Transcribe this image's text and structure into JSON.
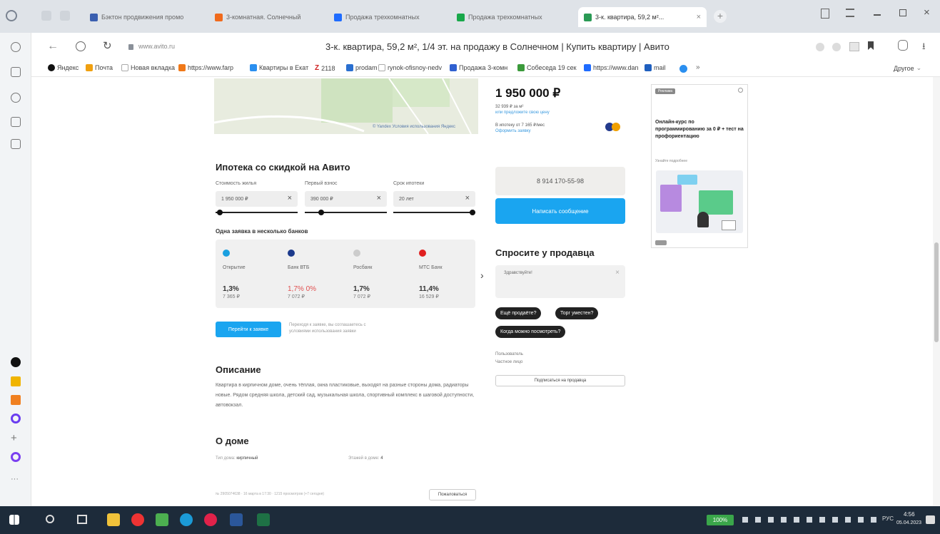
{
  "browser": {
    "tabs": [
      {
        "label": "Бэктон продвижения промо",
        "color": "#3a5fb0"
      },
      {
        "label": "3-комнатная. Солнечный",
        "color": "#f06a1c"
      },
      {
        "label": "Продажа трехкомнатных",
        "color": "#1f6cff"
      },
      {
        "label": "Продажа трехкомнатных",
        "color": "#18a84a"
      },
      {
        "label": "3-к. квартира, 59,2 м²...",
        "color": "#2a9a55"
      }
    ],
    "address": "www.avito.ru",
    "page_title": "3-к. квартира, 59,2 м², 1/4 эт. на продажу в Солнечном | Купить квартиру | Авито",
    "bookmarks": [
      {
        "label": "Яндекс",
        "color": "#e03131"
      },
      {
        "label": "Почта",
        "color": "#f0a010"
      },
      {
        "label": "Новая вкладка",
        "color": "#bbbbbb"
      },
      {
        "label": "https://www.farp",
        "color": "#f07818"
      },
      {
        "label": "Квартиры в Екат",
        "color": "#2a8ff0"
      },
      {
        "label": "2118",
        "color": "#d02020"
      },
      {
        "label": "prodam",
        "color": "#2a6fd0"
      },
      {
        "label": "rynok-ofisnoy-nedv",
        "color": "#999999"
      },
      {
        "label": "Продажа 3-комн",
        "color": "#3060d0"
      },
      {
        "label": "Собеседа 19 сек",
        "color": "#3b9a3b"
      },
      {
        "label": "https://www.dan",
        "color": "#1f6cff"
      },
      {
        "label": "mail",
        "color": "#1f5fbf"
      }
    ],
    "bookmarks_more": "Другое"
  },
  "map": {
    "attribution": "© Yandex  Условия использования  Яндекс"
  },
  "mortgage": {
    "title": "Ипотека со скидкой на Авито",
    "labels": [
      "Стоимость жилья",
      "Первый взнос",
      "Срок ипотеки"
    ],
    "values": [
      "1 950 000 ₽",
      "390 000 ₽",
      "20 лет"
    ],
    "slider_fractions": [
      0.05,
      0.2,
      1.0
    ],
    "multi_banks": "Одна заявка в несколько банков",
    "banks": [
      {
        "name": "Открытие",
        "rate": "1,3%",
        "pay": "7 365 ₽",
        "color": "#1aa0e0"
      },
      {
        "name": "Банк ВТБ",
        "rate": "1,7% 0%",
        "pay": "7 072 ₽",
        "color": "#1c3a8c"
      },
      {
        "name": "Росбанк",
        "rate": "1,7%",
        "pay": "7 072 ₽",
        "color": "#cccccc"
      },
      {
        "name": "МТС Банк",
        "rate": "11,4%",
        "pay": "16 529 ₽",
        "color": "#e02020"
      }
    ],
    "bank_arrow": "›",
    "button": "Перейти к заявке",
    "note": "Переходя к заявке, вы соглашаетесь с условиями использования заявки"
  },
  "description": {
    "title": "Описание",
    "text": "Квартира в кирпичном доме, очень тёплая, окна пластиковые, выходят на разные стороны дома, радиаторы новые. Рядом средняя школа, детский сад, музыкальная школа, спортивный комплекс в шаговой доступности, автовокзал."
  },
  "house": {
    "title": "О доме",
    "type_label": "Тип дома:",
    "type_value": "кирпичный",
    "floors_label": "Этажей в доме:",
    "floors_value": "4"
  },
  "footer": {
    "meta": "№ 2905074638 · 16 марта в 17:30 · 1215 просмотров (+7 сегодня)",
    "button": "Пожаловаться"
  },
  "listing": {
    "price": "1 950 000 ₽",
    "per_m2": "32 939 ₽ за м²",
    "offer_link": "или предложите свою цену",
    "mortgage_line": "В ипотеку от 7 165 ₽/мес",
    "mortgage_link": "Оформить заявку",
    "phone": "8 914 170-55-98",
    "write_button": "Написать сообщение",
    "ask_title": "Спросите у продавца",
    "ask_placeholder": "Здравствуйте!",
    "chips": [
      "Ещё продаёте?",
      "Торг уместен?",
      "Когда можно посмотреть?"
    ],
    "seller_type": "Пользователь",
    "seller_name": "Частное лицо",
    "subscribe": "Подписаться на продавца"
  },
  "ad": {
    "badge": "Реклама",
    "title": "Онлайн-курс по программированию за 0 ₽ + тест на профориентацию",
    "sub": "Узнайте подробнее"
  },
  "taskbar": {
    "zoom": "100%",
    "lang": "РУС",
    "time": "4:56",
    "date": "05.04.2023"
  }
}
